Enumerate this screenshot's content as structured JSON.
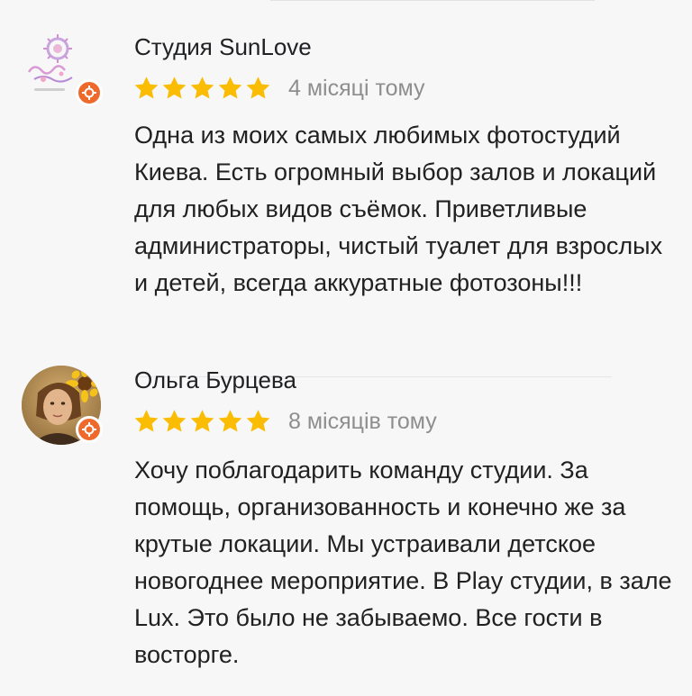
{
  "reviews": [
    {
      "author": "Студия SunLove",
      "stars": 5,
      "date": "4 місяці тому",
      "text": "Одна из моих самых любимых фотостудий Киева. Есть огромный выбор залов и локаций для любых видов съёмок. Приветливые администраторы, чистый туалет для взрослых и детей, всегда аккуратные фотозоны!!!",
      "avatar": "studio-logo",
      "badge": "local-guide-badge"
    },
    {
      "author": "Ольга Бурцева",
      "stars": 5,
      "date": "8 місяців тому",
      "text": "Хочу поблагодарить команду студии. За помощь, организованность и конечно же за крутые локации. Мы устраивали детское новогоднее мероприятие. В Play студии, в зале Lux. Это было не забываемо. Все гости в восторге.",
      "avatar": "profile-photo",
      "badge": "local-guide-badge"
    }
  ],
  "colors": {
    "star": "#fbbc04",
    "badge": "#ee6a2c",
    "date": "#8e8e8e"
  }
}
